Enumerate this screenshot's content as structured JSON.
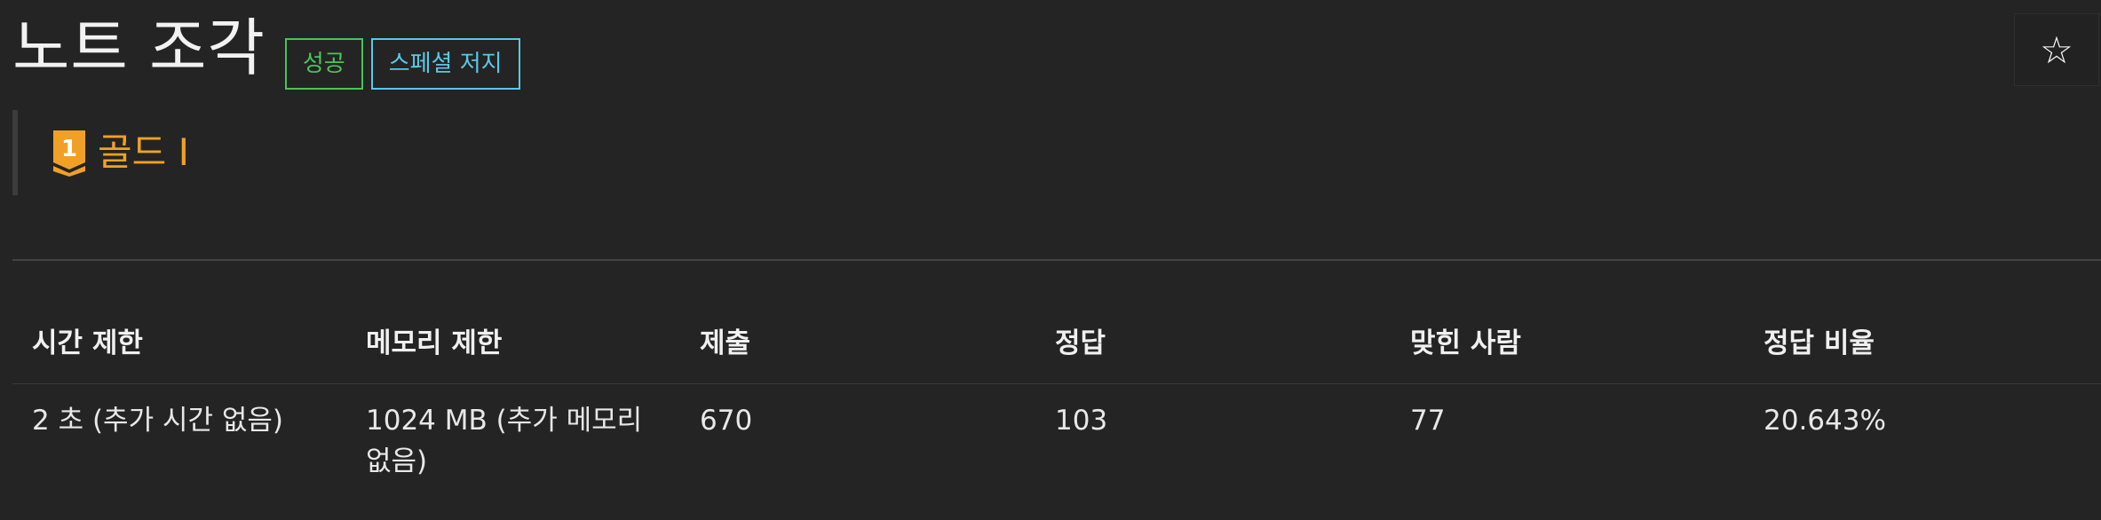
{
  "problem": {
    "title": "노트 조각",
    "labels": {
      "success": "성공",
      "special_judge": "스페셜 저지"
    }
  },
  "favorite_button": {
    "icon": "star-outline-icon",
    "glyph": "☆"
  },
  "tier": {
    "icon": "gold-tier-badge-icon",
    "level_number": "1",
    "label": "골드 I",
    "color": "#f0a125"
  },
  "info_table": {
    "headers": [
      "시간 제한",
      "메모리 제한",
      "제출",
      "정답",
      "맞힌 사람",
      "정답 비율"
    ],
    "values": [
      "2 초 (추가 시간 없음)",
      "1024 MB (추가 메모리 없음)",
      "670",
      "103",
      "77",
      "20.643%"
    ]
  },
  "colors": {
    "background": "#242424",
    "success": "#4cc35a",
    "special_judge": "#5bc8e6",
    "tier_gold": "#f0a125"
  }
}
